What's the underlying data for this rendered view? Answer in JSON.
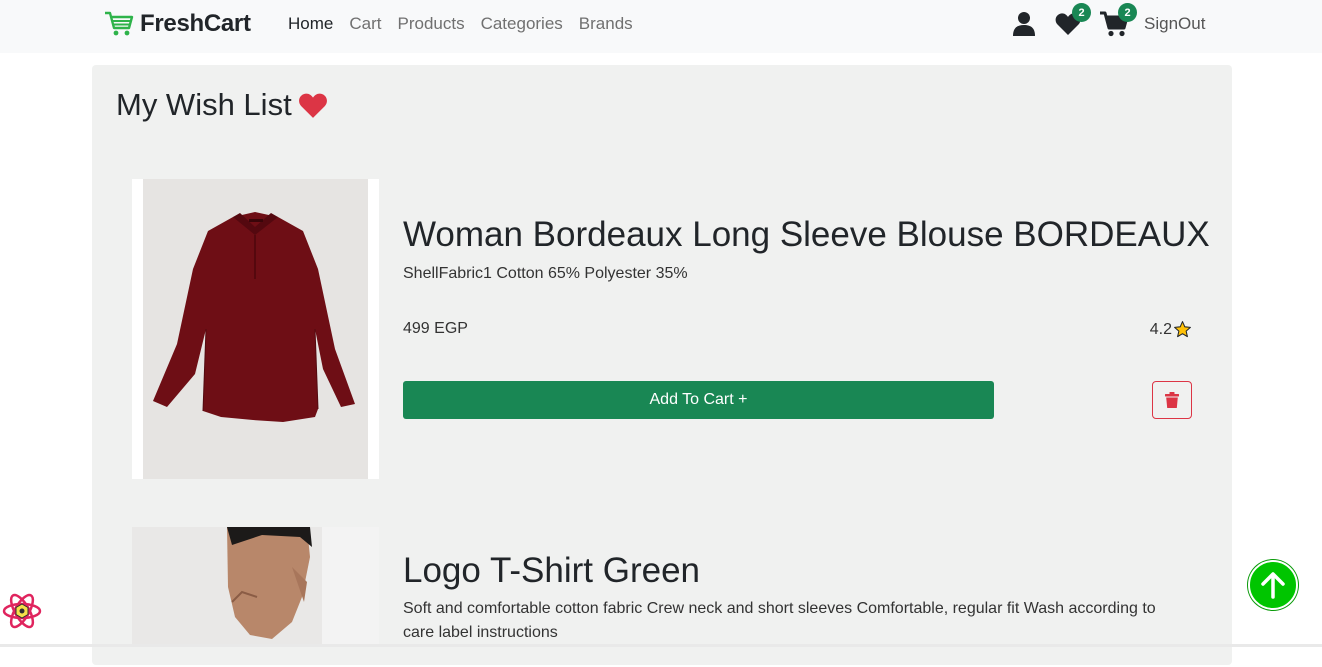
{
  "navbar": {
    "brand": "FreshCart",
    "links": [
      {
        "label": "Home",
        "active": true
      },
      {
        "label": "Cart",
        "active": false
      },
      {
        "label": "Products",
        "active": false
      },
      {
        "label": "Categories",
        "active": false
      },
      {
        "label": "Brands",
        "active": false
      }
    ],
    "wishlist_count": "2",
    "cart_count": "2",
    "signout": "SignOut",
    "icons": [
      "cart-logo-icon",
      "user-icon",
      "heart-icon",
      "cart-icon"
    ]
  },
  "page": {
    "title": "My Wish List",
    "title_icon": "heart-icon"
  },
  "products": [
    {
      "title": "Woman Bordeaux Long Sleeve Blouse BORDEAUX",
      "description": "ShellFabric1 Cotton 65% Polyester 35%",
      "price": "499 EGP",
      "rating": "4.2",
      "add_to_cart": "Add To Cart +"
    },
    {
      "title": "Logo T-Shirt Green",
      "description": "Soft and comfortable cotton fabric Crew neck and short sleeves Comfortable, regular fit Wash according to care label instructions"
    }
  ],
  "colors": {
    "brand_green": "#198754",
    "heart_red": "#dc3545",
    "scroll_top_green": "#00c500"
  }
}
